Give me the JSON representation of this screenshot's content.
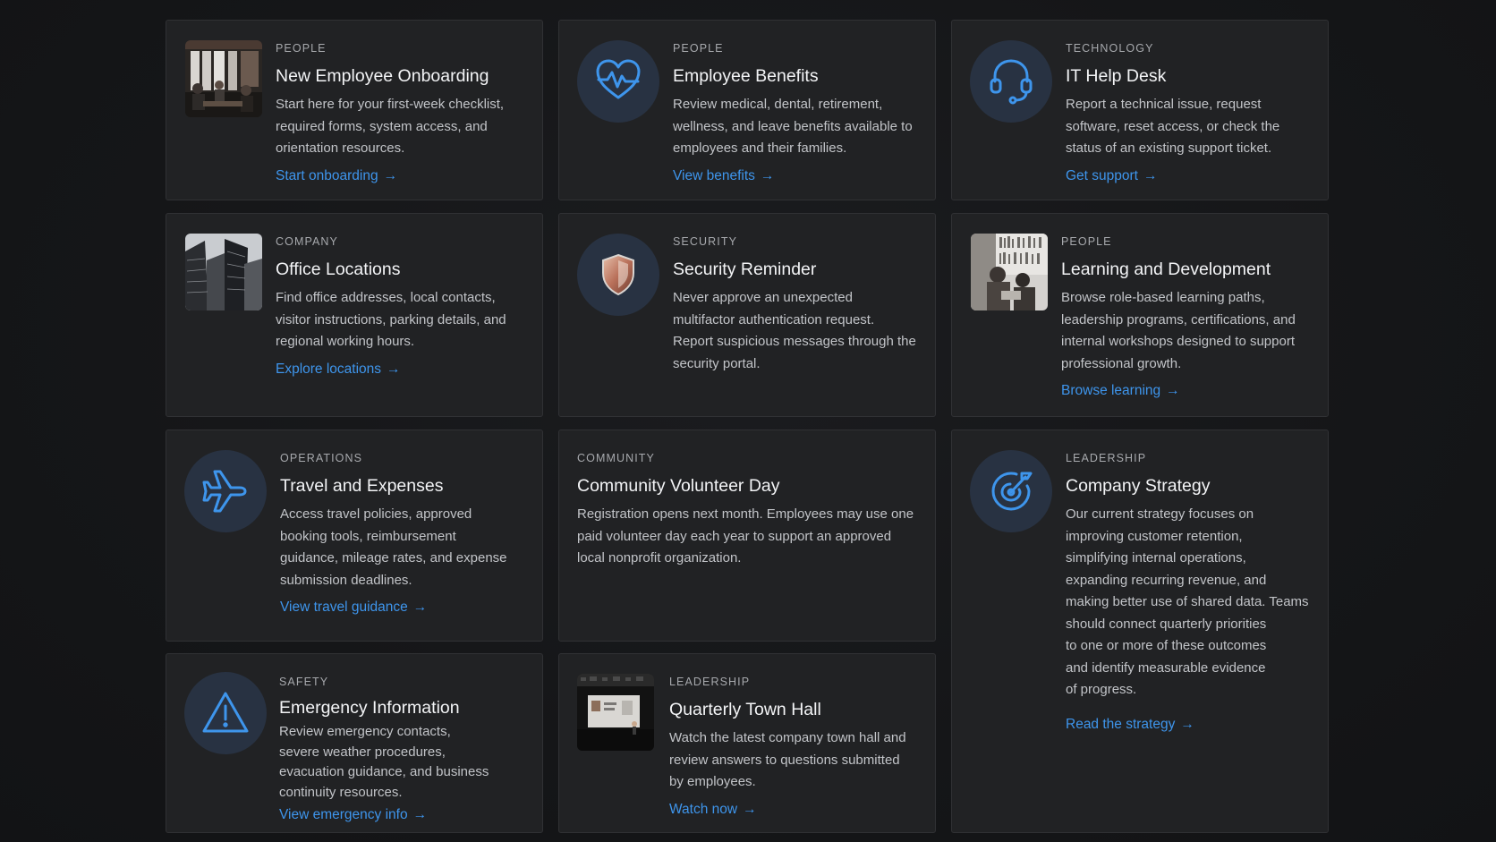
{
  "colors": {
    "page_background": "#151618",
    "card_background": "#212224",
    "accent": "#3e95ec",
    "icon_circle": "#283242"
  },
  "cards": [
    {
      "category": "People",
      "title": "New Employee Onboarding",
      "description": [
        "Start here for your first-week checklist,",
        "required forms, system access, and",
        "orientation resources."
      ],
      "link": "Start onboarding",
      "media": "meeting-room-photo"
    },
    {
      "category": "People",
      "title": "Employee Benefits",
      "description": [
        "Review medical, dental, retirement,",
        "wellness, and leave benefits available to",
        "employees and their families."
      ],
      "link": "View benefits",
      "media": "heartbeat-icon"
    },
    {
      "category": "Technology",
      "title": "IT Help Desk",
      "description": [
        "Report a technical issue, request",
        "software, reset access, or check the",
        "status of an existing support ticket."
      ],
      "link": "Get support",
      "media": "headset-icon"
    },
    {
      "category": "Company",
      "title": "Office Locations",
      "description": [
        "Find office addresses, local contacts,",
        "visitor instructions, parking details, and",
        "regional working hours."
      ],
      "link": "Explore locations",
      "media": "office-buildings-photo"
    },
    {
      "category": "Security",
      "title": "Security Reminder",
      "description": [
        "Never approve an unexpected",
        "multifactor authentication request.",
        "Report suspicious messages through the",
        "security portal."
      ],
      "link": "",
      "media": "shield-icon"
    },
    {
      "category": "People",
      "title": "Learning and Development",
      "description": [
        "Browse role-based learning paths,",
        "leadership programs, certifications, and",
        "internal workshops designed to support",
        "professional growth."
      ],
      "link": "Browse learning",
      "media": "library-photo"
    },
    {
      "category": "Operations",
      "title": "Travel and Expenses",
      "description": [
        "Access travel policies, approved",
        "booking tools, reimbursement",
        "guidance, mileage rates, and expense",
        "submission deadlines."
      ],
      "link": "View travel guidance",
      "media": "airplane-icon"
    },
    {
      "category": "Community",
      "title": "Community Volunteer Day",
      "description": [
        "Registration opens next month. Employees may use one",
        "paid volunteer day each year to support an approved",
        "local nonprofit organization."
      ],
      "link": "",
      "media": ""
    },
    {
      "category": "Leadership",
      "title": "Company Strategy",
      "description": [
        "Our current strategy focuses on",
        "improving customer retention,",
        "simplifying internal operations,",
        "expanding recurring revenue, and",
        "making better use of shared data. Teams",
        "should connect quarterly priorities",
        "to one or more of these outcomes",
        "and identify measurable evidence",
        "of progress."
      ],
      "link": "Read the strategy",
      "media": "target-icon"
    },
    {
      "category": "Safety",
      "title": "Emergency Information",
      "description": [
        "Review emergency contacts,",
        "severe weather procedures,",
        "evacuation guidance, and business",
        "continuity resources."
      ],
      "link": "View emergency info",
      "media": "warning-icon"
    },
    {
      "category": "Leadership",
      "title": "Quarterly Town Hall",
      "description": [
        "Watch the latest company town hall and",
        "review answers to questions submitted",
        "by employees."
      ],
      "link": "Watch now",
      "media": "town-hall-photo"
    }
  ],
  "arrow_glyph": "→"
}
